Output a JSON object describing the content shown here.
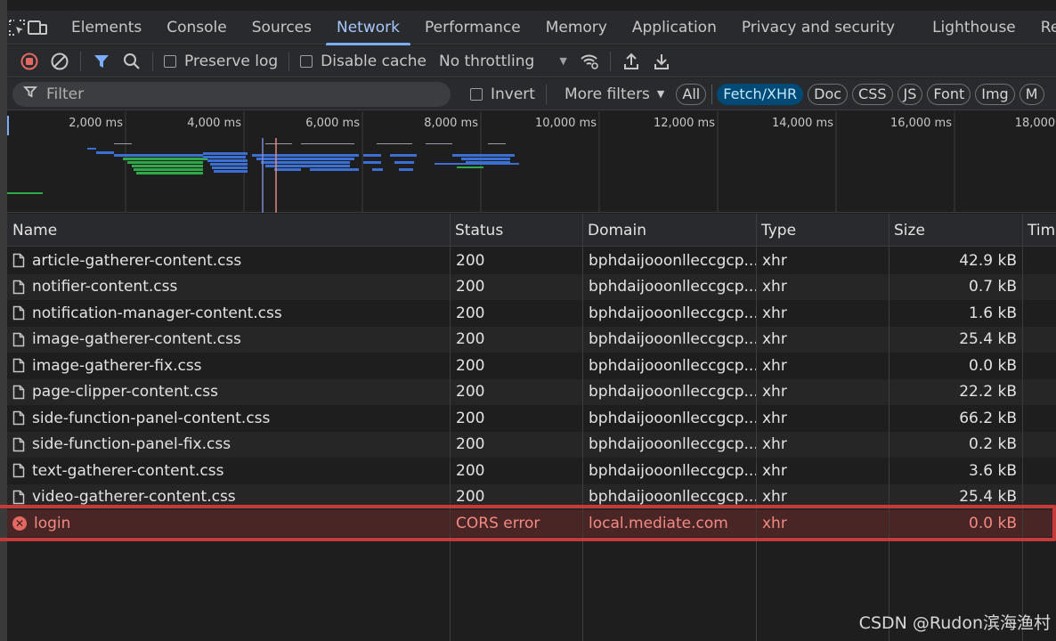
{
  "tabs": [
    "Elements",
    "Console",
    "Sources",
    "Network",
    "Performance",
    "Memory",
    "Application",
    "Privacy and security",
    "Lighthouse",
    "Re"
  ],
  "active_tab": "Network",
  "toolbar": {
    "preserve_log": "Preserve log",
    "disable_cache": "Disable cache",
    "throttling": "No throttling"
  },
  "filter": {
    "placeholder": "Filter",
    "invert": "Invert",
    "more_filters": "More filters",
    "types": [
      "All",
      "Fetch/XHR",
      "Doc",
      "CSS",
      "JS",
      "Font",
      "Img",
      "M"
    ],
    "active_type": "Fetch/XHR"
  },
  "overview": {
    "ticks": [
      "2,000 ms",
      "4,000 ms",
      "6,000 ms",
      "8,000 ms",
      "10,000 ms",
      "12,000 ms",
      "14,000 ms",
      "16,000 ms",
      "18,000 m"
    ]
  },
  "columns": [
    "Name",
    "Status",
    "Domain",
    "Type",
    "Size",
    "Tim"
  ],
  "rows": [
    {
      "name": "article-gatherer-content.css",
      "status": "200",
      "domain": "bphdaijooonlleccgcp...",
      "type": "xhr",
      "size": "42.9 kB"
    },
    {
      "name": "notifier-content.css",
      "status": "200",
      "domain": "bphdaijooonlleccgcp...",
      "type": "xhr",
      "size": "0.7 kB"
    },
    {
      "name": "notification-manager-content.css",
      "status": "200",
      "domain": "bphdaijooonlleccgcp...",
      "type": "xhr",
      "size": "1.6 kB"
    },
    {
      "name": "image-gatherer-content.css",
      "status": "200",
      "domain": "bphdaijooonlleccgcp...",
      "type": "xhr",
      "size": "25.4 kB"
    },
    {
      "name": "image-gatherer-fix.css",
      "status": "200",
      "domain": "bphdaijooonlleccgcp...",
      "type": "xhr",
      "size": "0.0 kB"
    },
    {
      "name": "page-clipper-content.css",
      "status": "200",
      "domain": "bphdaijooonlleccgcp...",
      "type": "xhr",
      "size": "22.2 kB"
    },
    {
      "name": "side-function-panel-content.css",
      "status": "200",
      "domain": "bphdaijooonlleccgcp...",
      "type": "xhr",
      "size": "66.2 kB"
    },
    {
      "name": "side-function-panel-fix.css",
      "status": "200",
      "domain": "bphdaijooonlleccgcp...",
      "type": "xhr",
      "size": "0.2 kB"
    },
    {
      "name": "text-gatherer-content.css",
      "status": "200",
      "domain": "bphdaijooonlleccgcp...",
      "type": "xhr",
      "size": "3.6 kB"
    },
    {
      "name": "video-gatherer-content.css",
      "status": "200",
      "domain": "bphdaijooonlleccgcp...",
      "type": "xhr",
      "size": "25.4 kB"
    },
    {
      "name": "login",
      "status": "CORS error",
      "domain": "local.mediate.com",
      "type": "xhr",
      "size": "0.0 kB",
      "error": true
    }
  ],
  "watermark": "CSDN @Rudon滨海渔村",
  "colors": {
    "accent": "#7cacf8",
    "error": "#f28b82",
    "highlight": "#c73a3a",
    "bar_green": "#2fa84a",
    "bar_blue": "#3b6fd4"
  }
}
